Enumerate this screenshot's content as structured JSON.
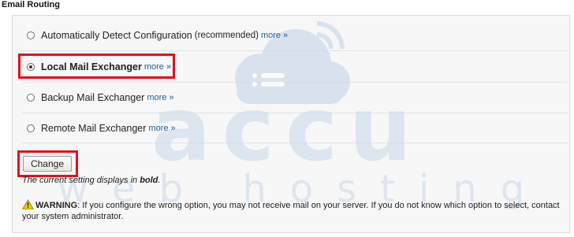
{
  "page": {
    "title": "Email Routing"
  },
  "options": [
    {
      "label": "Automatically Detect Configuration",
      "note": "(recommended)",
      "more": "more »",
      "selected": false,
      "current": false
    },
    {
      "label": "Local Mail Exchanger",
      "note": "",
      "more": "more »",
      "selected": true,
      "current": true
    },
    {
      "label": "Backup Mail Exchanger",
      "note": "",
      "more": "more »",
      "selected": false,
      "current": false
    },
    {
      "label": "Remote Mail Exchanger",
      "note": "",
      "more": "more »",
      "selected": false,
      "current": false
    }
  ],
  "actions": {
    "change_label": "Change"
  },
  "note": {
    "prefix": "The current setting displays in ",
    "emphasis": "bold",
    "suffix": "."
  },
  "warning": {
    "label": "WARNING",
    "text": ": If you configure the wrong option, you may not receive mail on your server. If you do not know which option to select, contact your system administrator."
  },
  "watermark": {
    "line1": "accu",
    "line2": "web hosting"
  },
  "colors": {
    "link": "#1e5e9e",
    "highlight": "#e0121a",
    "watermark": "#c9d8ea"
  },
  "icons": {
    "warning": "warning-triangle-icon",
    "watermark_cloud": "cloud-icon"
  }
}
